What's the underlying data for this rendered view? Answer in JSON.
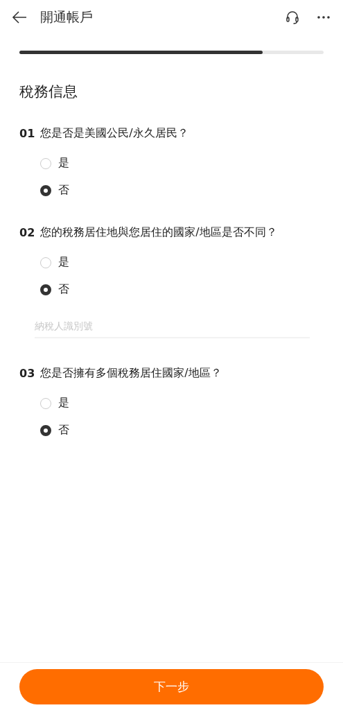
{
  "header": {
    "title": "開通帳戶"
  },
  "progress": {
    "level": 0.8
  },
  "section_title": "稅務信息",
  "questions": [
    {
      "number": "01",
      "text": "您是否是美國公民/永久居民？",
      "options": [
        {
          "label": "是",
          "selected": false
        },
        {
          "label": "否",
          "selected": true
        }
      ]
    },
    {
      "number": "02",
      "text": "您的稅務居住地與您居住的國家/地區是否不同？",
      "options": [
        {
          "label": "是",
          "selected": false
        },
        {
          "label": "否",
          "selected": true
        }
      ],
      "field": {
        "placeholder": "納稅人識別號"
      }
    },
    {
      "number": "03",
      "text": "您是否擁有多個稅務居住國家/地區？",
      "options": [
        {
          "label": "是",
          "selected": false
        },
        {
          "label": "否",
          "selected": true
        }
      ]
    }
  ],
  "next_button": "下一步"
}
